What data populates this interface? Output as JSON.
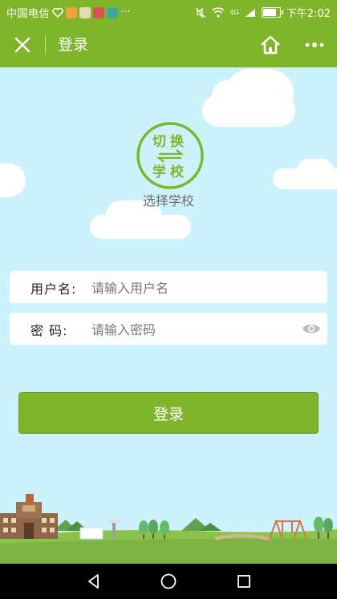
{
  "status_bar": {
    "carrier": "中国电信",
    "network": "4G",
    "time": "下午2:02",
    "battery_level": 0.9,
    "notification_dots": "···"
  },
  "header": {
    "title": "登录",
    "close_icon": "close-icon",
    "home_icon": "home-icon",
    "more_icon": "more-icon"
  },
  "school_switch": {
    "badge_top": "切换",
    "badge_bottom": "学校",
    "label": "选择学校"
  },
  "form": {
    "username_label": "用户名:",
    "username_placeholder": "请输入用户名",
    "password_label": "密 码:",
    "password_placeholder": "请输入密码"
  },
  "login_button": "登录",
  "colors": {
    "brand_green": "#7fb52b",
    "sky": "#ccf2fb",
    "ground": "#8bc34a"
  }
}
